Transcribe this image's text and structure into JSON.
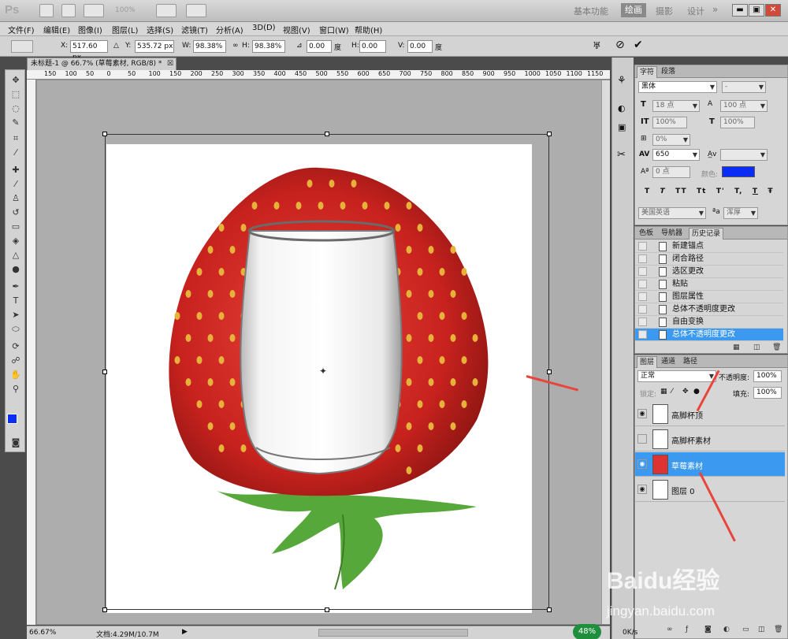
{
  "app": {
    "logo": "Ps",
    "zoom_dropdown": "100%"
  },
  "workspaces": {
    "basic": "基本功能",
    "paint": "绘画",
    "photo": "摄影",
    "design": "设计",
    "more": "»"
  },
  "window_controls": {
    "minimize": "▬",
    "restore": "▣",
    "close": "✕"
  },
  "menu": [
    "文件(F)",
    "编辑(E)",
    "图像(I)",
    "图层(L)",
    "选择(S)",
    "滤镜(T)",
    "分析(A)",
    "3D(D)",
    "视图(V)",
    "窗口(W)",
    "帮助(H)"
  ],
  "options": {
    "x_label": "X:",
    "x_value": "517.60 px",
    "y_label": "Y:",
    "y_value": "535.72 px",
    "w_label": "W:",
    "w_value": "98.38%",
    "h_label": "H:",
    "h_value": "98.38%",
    "angle_value": "0.00",
    "angle_unit": "度",
    "hskew_label": "H:",
    "hskew_value": "0.00",
    "vskew_label": "V:",
    "vskew_value": "0.00",
    "vskew_unit": "度"
  },
  "document": {
    "tab_title": "未标题-1 @ 66.7% (草莓素材, RGB/8) *",
    "ruler_ticks": [
      "150",
      "100",
      "50",
      "0",
      "50",
      "100",
      "150",
      "200",
      "250",
      "300",
      "350",
      "400",
      "450",
      "500",
      "550",
      "600",
      "650",
      "700",
      "750",
      "800",
      "850",
      "900",
      "950",
      "1000",
      "1050",
      "1100",
      "1150"
    ]
  },
  "status": {
    "zoom": "66.67%",
    "doc_size": "文档:4.29M/10.7M"
  },
  "character_panel": {
    "tabs": [
      "字符",
      "段落"
    ],
    "font_family": "黑体",
    "font_style": "-",
    "font_size": "18 点",
    "leading": "100 点",
    "vscale": "100%",
    "hscale": "100%",
    "tsume": "0%",
    "tracking": "650",
    "kerning": "",
    "baseline": "0 点",
    "color_label": "颜色:",
    "color": "#0a2cf5",
    "styles": [
      "T",
      "T",
      "TT",
      "Tt",
      "T'",
      "T,",
      "T",
      "Ŧ"
    ],
    "language": "美国英语",
    "aa_label": "ªa",
    "antialias": "浑厚"
  },
  "history_panel": {
    "tabs": [
      "色板",
      "导航器",
      "历史记录"
    ],
    "items": [
      "新建锚点",
      "闭合路径",
      "选区更改",
      "粘贴",
      "图层属性",
      "总体不透明度更改",
      "自由变换",
      "总体不透明度更改"
    ]
  },
  "layers_panel": {
    "tabs": [
      "图层",
      "通道",
      "路径"
    ],
    "blend_mode": "正常",
    "opacity_label": "不透明度:",
    "opacity": "100%",
    "lock_label": "锁定:",
    "fill_label": "填充:",
    "fill": "100%",
    "layers": [
      {
        "name": "高脚杯顶",
        "visible": true
      },
      {
        "name": "高脚杯素材",
        "visible": false
      },
      {
        "name": "草莓素材",
        "visible": true
      },
      {
        "name": "图层 0",
        "visible": true
      }
    ]
  },
  "taskbar": {
    "percent": "48%",
    "net_speed": "0K/s"
  },
  "watermark": {
    "brand": "Baidu经验",
    "url": "jingyan.baidu.com"
  }
}
